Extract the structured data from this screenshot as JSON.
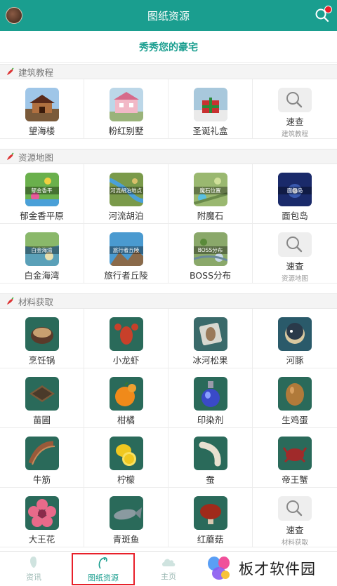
{
  "header": {
    "title": "图纸资源"
  },
  "banner": {
    "text": "秀秀您的豪宅"
  },
  "sections": [
    {
      "title": "建筑教程",
      "items": [
        {
          "label": "望海楼",
          "image": "building-temple"
        },
        {
          "label": "粉红别墅",
          "image": "building-villa"
        },
        {
          "label": "圣诞礼盒",
          "image": "building-christmas"
        },
        {
          "label": "速查",
          "sub": "建筑教程",
          "image": "search-icon"
        }
      ]
    },
    {
      "title": "资源地图",
      "items": [
        {
          "label": "郁金香平原",
          "image": "map-tulip",
          "caption": "郁金香平"
        },
        {
          "label": "河流胡泊",
          "image": "map-river",
          "caption": "河流胡泊地点"
        },
        {
          "label": "附魔石",
          "image": "map-enchant",
          "caption": "魔石位置"
        },
        {
          "label": "面包岛",
          "image": "map-bread",
          "caption": "面包岛"
        },
        {
          "label": "白金海湾",
          "image": "map-bay",
          "caption": "白金海湾"
        },
        {
          "label": "旅行者丘陵",
          "image": "map-hills",
          "caption": "旅行者丘陵"
        },
        {
          "label": "BOSS分布",
          "image": "map-boss",
          "caption": "BOSS分布"
        },
        {
          "label": "速查",
          "sub": "资源地图",
          "image": "search-icon"
        }
      ]
    },
    {
      "title": "材料获取",
      "items": [
        {
          "label": "烹饪锅",
          "image": "cooking-pot"
        },
        {
          "label": "小龙虾",
          "image": "crayfish"
        },
        {
          "label": "冰河松果",
          "image": "pinecone"
        },
        {
          "label": "河豚",
          "image": "pufferfish"
        },
        {
          "label": "苗圃",
          "image": "nursery"
        },
        {
          "label": "柑橘",
          "image": "orange"
        },
        {
          "label": "印染剂",
          "image": "dye-bottle"
        },
        {
          "label": "生鸡蛋",
          "image": "egg"
        },
        {
          "label": "牛筋",
          "image": "tendon"
        },
        {
          "label": "柠檬",
          "image": "lemon"
        },
        {
          "label": "蚕",
          "image": "silkworm"
        },
        {
          "label": "帝王蟹",
          "image": "king-crab"
        },
        {
          "label": "大王花",
          "image": "rafflesia"
        },
        {
          "label": "青斑鱼",
          "image": "grouper"
        },
        {
          "label": "红蘑菇",
          "image": "red-mushroom"
        },
        {
          "label": "速查",
          "sub": "材料获取",
          "image": "search-icon"
        }
      ]
    }
  ],
  "bottom_nav": [
    {
      "label": "资讯",
      "icon": "info-icon",
      "active": false
    },
    {
      "label": "图纸资源",
      "icon": "blueprint-icon",
      "active": true
    },
    {
      "label": "主页",
      "icon": "home-cloud-icon",
      "active": false
    }
  ],
  "watermark": {
    "text": "板才软件园"
  },
  "colors": {
    "primary": "#1a9e8f",
    "accent_red": "#e8202a"
  }
}
